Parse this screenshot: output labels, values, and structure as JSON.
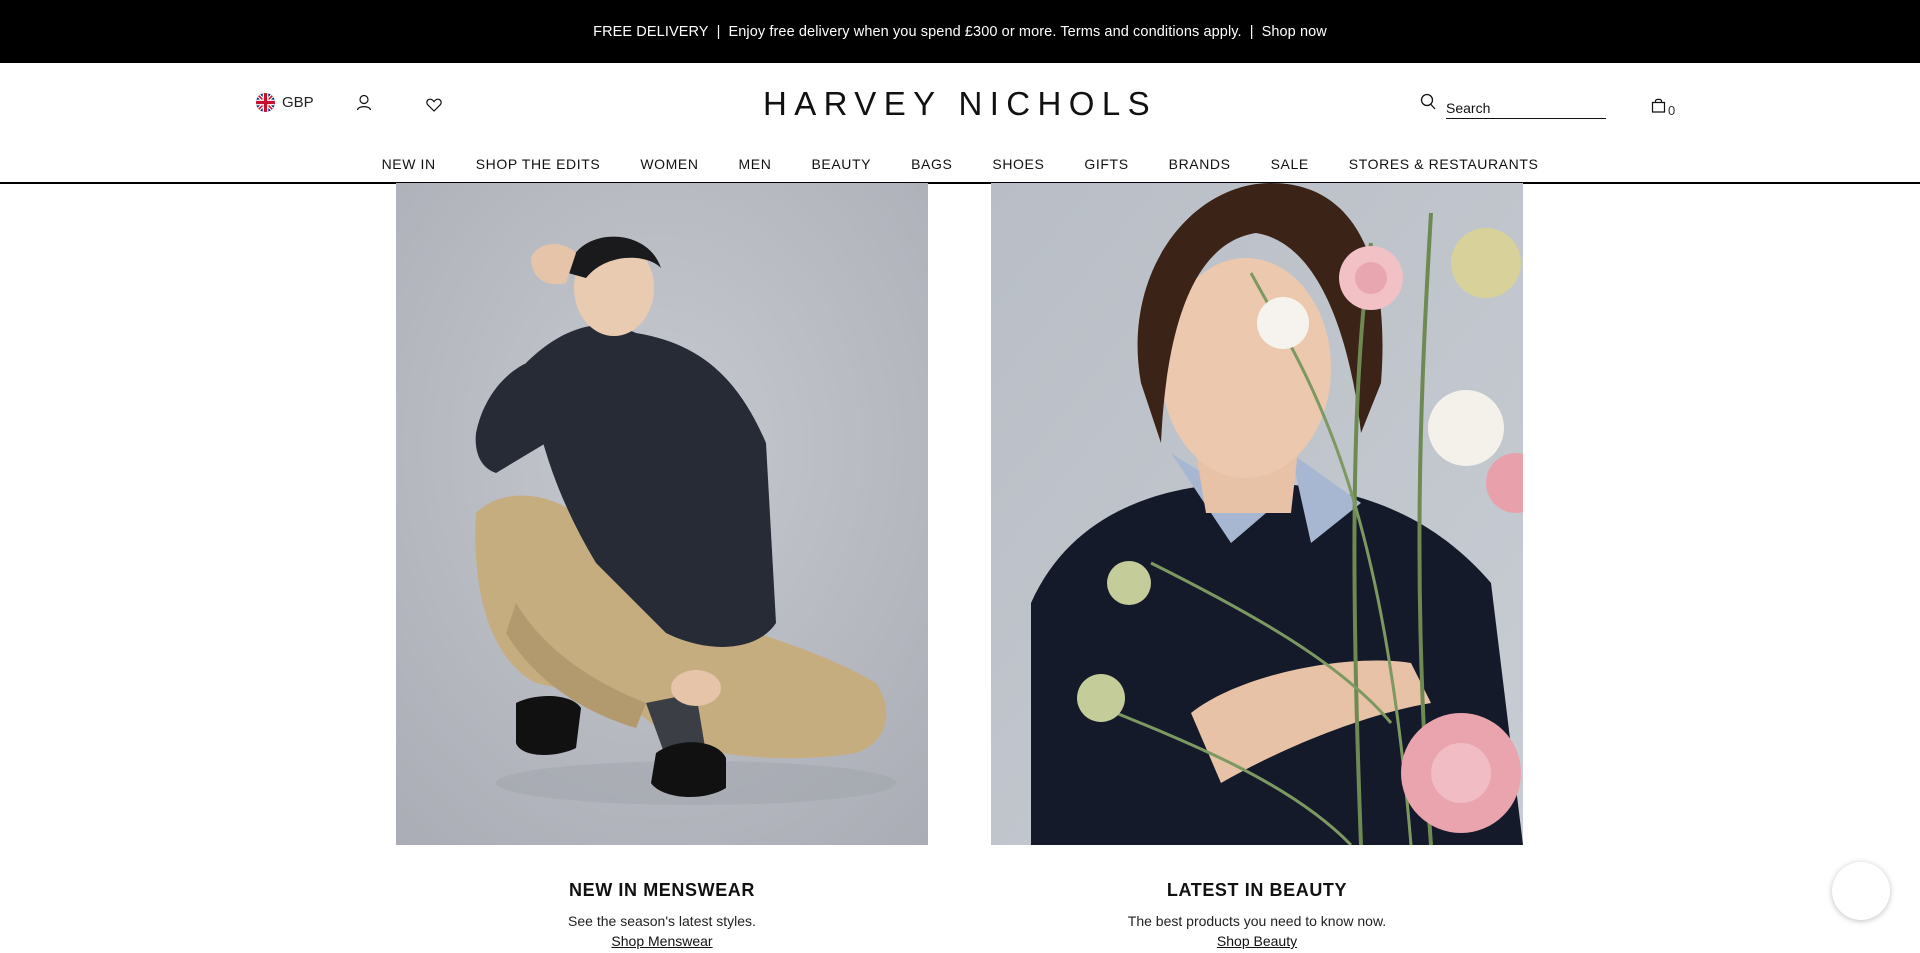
{
  "promo_bar": {
    "part1": "FREE DELIVERY",
    "separator": "|",
    "part2": "Enjoy free delivery when you spend £300 or more. Terms and conditions apply.",
    "link": "Shop now",
    "background": "#000000",
    "text_color": "#ffffff"
  },
  "header": {
    "currency": "GBP",
    "logo": "HARVEY NICHOLS",
    "search": {
      "placeholder": "Search"
    },
    "bag_count": "0",
    "icons": {
      "flag": "uk-flag-icon",
      "account": "user-icon",
      "wishlist": "heart-icon",
      "search": "search-icon",
      "bag": "shopping-bag-icon"
    }
  },
  "nav": {
    "items": [
      {
        "label": "NEW IN"
      },
      {
        "label": "SHOP THE EDITS"
      },
      {
        "label": "WOMEN"
      },
      {
        "label": "MEN"
      },
      {
        "label": "BEAUTY"
      },
      {
        "label": "BAGS"
      },
      {
        "label": "SHOES"
      },
      {
        "label": "GIFTS"
      },
      {
        "label": "BRANDS"
      },
      {
        "label": "SALE"
      },
      {
        "label": "STORES & RESTAURANTS"
      }
    ]
  },
  "promos": [
    {
      "title": "NEW IN MENSWEAR",
      "subtitle": "See the season's latest styles.",
      "link": "Shop Menswear"
    },
    {
      "title": "LATEST IN BEAUTY",
      "subtitle": "The best products you need to know now.",
      "link": "Shop Beauty"
    }
  ],
  "chat": {
    "icon": "chat-icon"
  }
}
